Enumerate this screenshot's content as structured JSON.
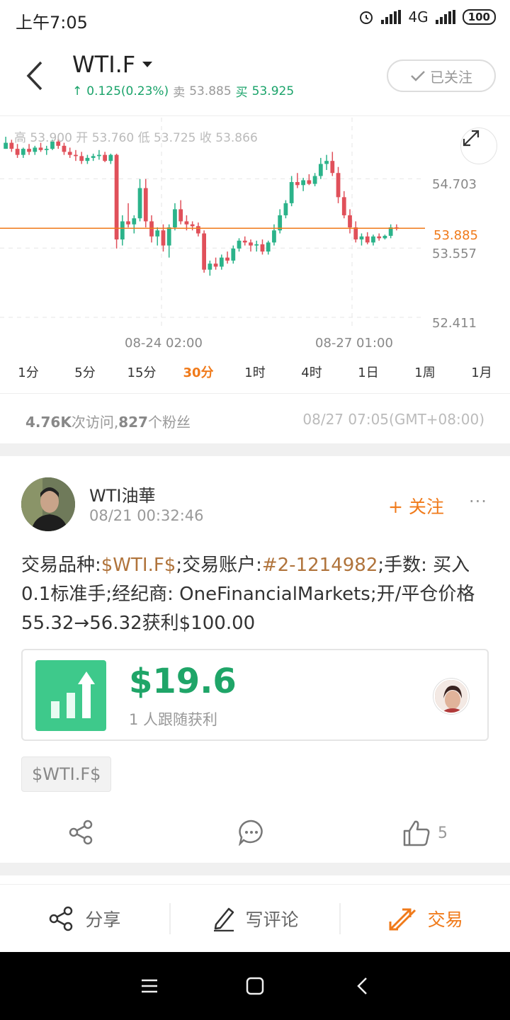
{
  "status_bar": {
    "time": "上午7:05",
    "network": "4G",
    "battery": "100"
  },
  "header": {
    "symbol": "WTI.F",
    "change": "0.125(0.23%)",
    "sell_label": "卖",
    "sell_price": "53.885",
    "buy_label": "买",
    "buy_price": "53.925",
    "follow_state": "已关注"
  },
  "chart": {
    "ohlc": "高 53.900  开 53.760  低 53.725  收 53.866",
    "y_labels": [
      "54.703",
      "53.557",
      "52.411"
    ],
    "current_price": "53.885",
    "x_labels": [
      "08-24 02:00",
      "08-27 01:00"
    ],
    "up_color": "#2bb38a",
    "down_color": "#e0505a",
    "price_line_color": "#f07a1a"
  },
  "chart_data": {
    "type": "candlestick",
    "ylim": [
      52.2,
      55.6
    ],
    "current": 53.885,
    "candles": [
      [
        55.2,
        55.4,
        55.2,
        55.3
      ],
      [
        55.3,
        55.35,
        55.15,
        55.2
      ],
      [
        55.2,
        55.28,
        55.05,
        55.1
      ],
      [
        55.1,
        55.22,
        55.05,
        55.2
      ],
      [
        55.2,
        55.28,
        55.1,
        55.15
      ],
      [
        55.15,
        55.25,
        55.1,
        55.22
      ],
      [
        55.22,
        55.3,
        55.15,
        55.18
      ],
      [
        55.18,
        55.25,
        55.1,
        55.2
      ],
      [
        55.2,
        55.35,
        55.18,
        55.32
      ],
      [
        55.32,
        55.38,
        55.2,
        55.25
      ],
      [
        55.25,
        55.3,
        55.1,
        55.15
      ],
      [
        55.15,
        55.22,
        55.05,
        55.1
      ],
      [
        55.1,
        55.18,
        55.0,
        55.08
      ],
      [
        55.08,
        55.15,
        54.95,
        55.0
      ],
      [
        55.0,
        55.1,
        54.95,
        55.05
      ],
      [
        55.05,
        55.12,
        55.0,
        55.08
      ],
      [
        55.08,
        55.18,
        55.02,
        55.1
      ],
      [
        55.1,
        55.15,
        54.98,
        55.0
      ],
      [
        55.0,
        55.12,
        54.95,
        55.1
      ],
      [
        55.1,
        55.12,
        53.55,
        53.7
      ],
      [
        53.7,
        54.1,
        53.6,
        54.0
      ],
      [
        54.0,
        54.3,
        53.9,
        53.95
      ],
      [
        53.95,
        54.1,
        53.8,
        54.05
      ],
      [
        54.05,
        54.7,
        54.0,
        54.55
      ],
      [
        54.55,
        54.7,
        53.9,
        54.0
      ],
      [
        54.0,
        54.1,
        53.65,
        53.75
      ],
      [
        53.75,
        53.9,
        53.6,
        53.85
      ],
      [
        53.85,
        53.95,
        53.5,
        53.6
      ],
      [
        53.6,
        53.95,
        53.4,
        53.9
      ],
      [
        53.9,
        54.3,
        53.85,
        54.2
      ],
      [
        54.2,
        54.35,
        53.95,
        54.0
      ],
      [
        54.0,
        54.1,
        53.85,
        53.95
      ],
      [
        53.95,
        54.0,
        53.85,
        53.92
      ],
      [
        53.92,
        53.98,
        53.75,
        53.8
      ],
      [
        53.8,
        53.85,
        53.15,
        53.2
      ],
      [
        53.2,
        53.35,
        53.1,
        53.3
      ],
      [
        53.3,
        53.4,
        53.2,
        53.25
      ],
      [
        53.25,
        53.45,
        53.2,
        53.4
      ],
      [
        53.4,
        53.5,
        53.3,
        53.35
      ],
      [
        53.35,
        53.6,
        53.3,
        53.55
      ],
      [
        53.55,
        53.72,
        53.5,
        53.68
      ],
      [
        53.68,
        53.75,
        53.6,
        53.65
      ],
      [
        53.65,
        53.7,
        53.5,
        53.6
      ],
      [
        53.6,
        53.68,
        53.5,
        53.62
      ],
      [
        53.62,
        53.7,
        53.45,
        53.5
      ],
      [
        53.5,
        53.68,
        53.45,
        53.65
      ],
      [
        53.65,
        53.95,
        53.6,
        53.85
      ],
      [
        53.85,
        54.2,
        53.8,
        54.1
      ],
      [
        54.1,
        54.35,
        54.05,
        54.3
      ],
      [
        54.3,
        54.75,
        54.25,
        54.65
      ],
      [
        54.65,
        54.8,
        54.55,
        54.6
      ],
      [
        54.6,
        54.72,
        54.5,
        54.68
      ],
      [
        54.68,
        54.78,
        54.6,
        54.62
      ],
      [
        54.62,
        54.8,
        54.58,
        54.75
      ],
      [
        54.75,
        55.05,
        54.7,
        54.95
      ],
      [
        54.95,
        55.1,
        54.85,
        55.0
      ],
      [
        55.0,
        55.15,
        54.75,
        54.8
      ],
      [
        54.8,
        54.9,
        54.3,
        54.4
      ],
      [
        54.4,
        54.5,
        54.05,
        54.1
      ],
      [
        54.1,
        54.2,
        53.8,
        53.9
      ],
      [
        53.9,
        54.0,
        53.65,
        53.7
      ],
      [
        53.7,
        53.8,
        53.6,
        53.75
      ],
      [
        53.75,
        53.82,
        53.62,
        53.65
      ],
      [
        53.65,
        53.78,
        53.6,
        53.75
      ],
      [
        53.75,
        53.8,
        53.68,
        53.72
      ],
      [
        53.72,
        53.78,
        53.7,
        53.76
      ],
      [
        53.76,
        53.95,
        53.72,
        53.9
      ],
      [
        53.9,
        53.95,
        53.85,
        53.88
      ]
    ]
  },
  "periods": [
    "1分",
    "5分",
    "15分",
    "30分",
    "1时",
    "4时",
    "1日",
    "1周",
    "1月"
  ],
  "active_period": "30分",
  "stats": {
    "visits": "4.76K",
    "visits_label": "次访问,",
    "fans": "827",
    "fans_label": "个粉丝",
    "datetime": "08/27 07:05(GMT+08:00)"
  },
  "post": {
    "user_name": "WTI油華",
    "date": "08/21 00:32:46",
    "follow_label": "关注",
    "text_parts": {
      "p1": "交易品种:",
      "symbol_link": "$WTI.F$",
      "p2": ";交易账户:",
      "account_link": "#2-1214982",
      "p3": ";手数: 买入 0.1标准手;经纪商: OneFinancialMarkets;开/平仓价格55.32→56.32获利$100.00"
    },
    "profit_amount": "$19.6",
    "profit_label": "1 人跟随获利",
    "tag": "$WTI.F$",
    "like_count": "5"
  },
  "toolbar": {
    "share": "分享",
    "comment": "写评论",
    "trade": "交易"
  }
}
